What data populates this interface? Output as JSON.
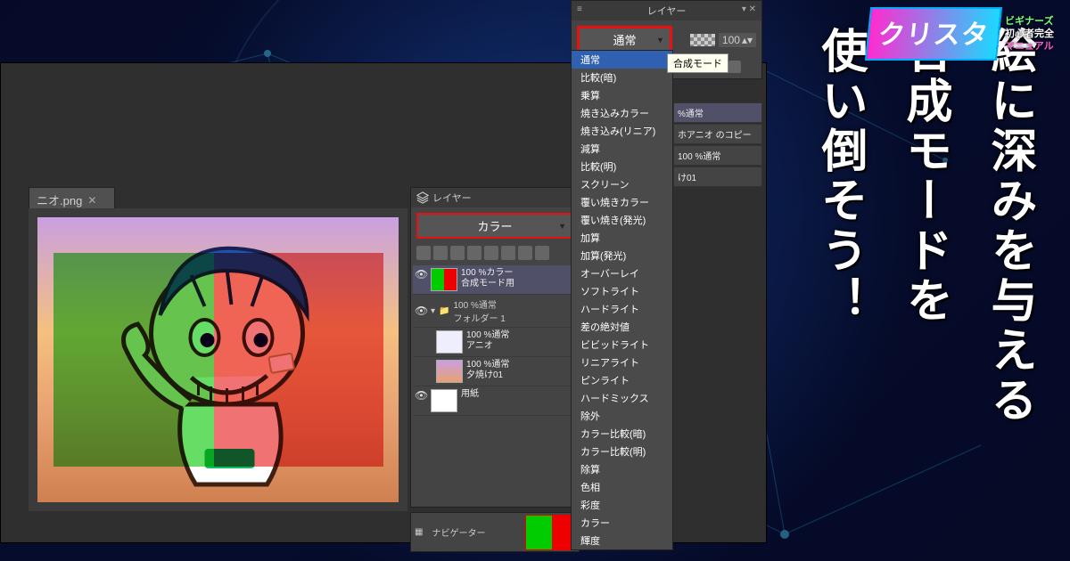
{
  "app": {
    "file_tab": "ニオ.png",
    "panel_title_left": "レイヤー",
    "panel_title_right": "レイヤー",
    "navigator_title": "ナビゲーター"
  },
  "blend": {
    "selected_left": "カラー",
    "selected_right": "通常",
    "tooltip": "合成モード",
    "modes": [
      "通常",
      "比較(暗)",
      "乗算",
      "焼き込みカラー",
      "焼き込み(リニア)",
      "減算",
      "比較(明)",
      "スクリーン",
      "覆い焼きカラー",
      "覆い焼き(発光)",
      "加算",
      "加算(発光)",
      "オーバーレイ",
      "ソフトライト",
      "ハードライト",
      "差の絶対値",
      "ビビッドライト",
      "リニアライト",
      "ピンライト",
      "ハードミックス",
      "除外",
      "カラー比較(暗)",
      "カラー比較(明)",
      "除算",
      "色相",
      "彩度",
      "カラー",
      "輝度"
    ]
  },
  "opacity": {
    "value": "100"
  },
  "layers_left": {
    "row0": {
      "pct": "100 %カラー",
      "name": "合成モード用"
    },
    "folder": {
      "pct": "100 %通常",
      "name": "フォルダー 1"
    },
    "row1": {
      "pct": "100 %通常",
      "name": "アニオ"
    },
    "row2": {
      "pct": "100 %通常",
      "name": "夕焼け01"
    },
    "row_paper": {
      "name": "用紙"
    }
  },
  "layers_right": {
    "r0": "%通常",
    "r1": "ホアニオ のコピー",
    "r2": "100 %通常",
    "r3": "け01"
  },
  "headline": {
    "line1": "絵に深みを与える",
    "line2": "合成モードを",
    "line3": "使い倒そう！"
  },
  "logo": {
    "brand": "クリスタ",
    "sub1": "ビギナーズ",
    "sub2": "初心者完全",
    "sub3": "マニュアル"
  }
}
